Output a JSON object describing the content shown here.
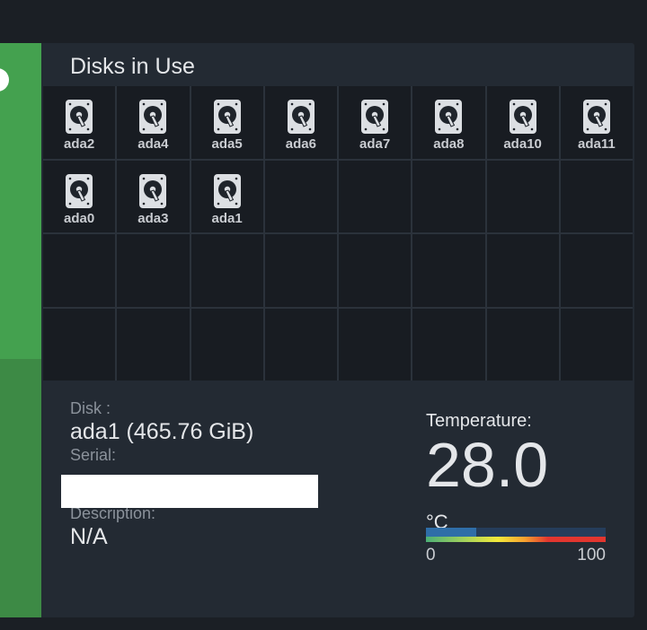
{
  "widget": {
    "title": "Disks in Use"
  },
  "disks": [
    {
      "name": "ada2"
    },
    {
      "name": "ada4"
    },
    {
      "name": "ada5"
    },
    {
      "name": "ada6"
    },
    {
      "name": "ada7"
    },
    {
      "name": "ada8"
    },
    {
      "name": "ada10"
    },
    {
      "name": "ada11"
    },
    {
      "name": "ada0"
    },
    {
      "name": "ada3"
    },
    {
      "name": "ada1"
    }
  ],
  "details": {
    "disk_label": "Disk :",
    "disk_value": "ada1 (465.76 GiB)",
    "serial_label": "Serial:",
    "description_label": "Description:",
    "description_value": "N/A"
  },
  "temperature": {
    "label": "Temperature:",
    "value": "28.0",
    "unit": "°C",
    "level_percent": 28,
    "scale_min": "0",
    "scale_max": "100"
  },
  "colors": {
    "accent_green": "#44a14f",
    "card_bg": "#232a33",
    "cell_bg": "#181c22"
  }
}
